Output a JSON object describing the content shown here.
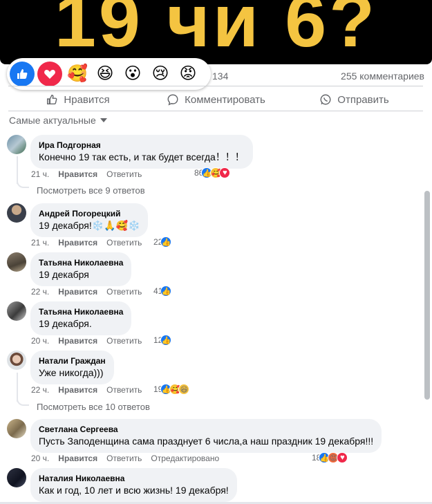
{
  "hero": {
    "text": "19 чи 6?",
    "accent": "#f4c441"
  },
  "reactions": {
    "icons": [
      "like-icon",
      "love-icon",
      "care-icon",
      "haha-icon",
      "wow-icon",
      "sad-icon",
      "angry-icon"
    ],
    "count": "134",
    "comments_count": "255 комментариев"
  },
  "actions": {
    "like": "Нравится",
    "comment": "Комментировать",
    "share": "Отправить"
  },
  "sort": {
    "label": "Самые актуальные"
  },
  "comments": [
    {
      "author": "Ира Подгорная",
      "text": "Конечно 19 так есть, и так будет всегда！！！",
      "time": "21 ч.",
      "like": "Нравится",
      "reply": "Ответить",
      "edited": "",
      "reactions_count": "86",
      "view_replies": "Посмотреть все 9 ответов"
    },
    {
      "author": "Андрей Погорецкий",
      "text": "19 декабря!❄️🙏🥰❄️",
      "time": "21 ч.",
      "like": "Нравится",
      "reply": "Ответить",
      "edited": "",
      "reactions_count": "22",
      "view_replies": ""
    },
    {
      "author": "Татьяна Николаевна",
      "text": "19 декабря",
      "time": "22 ч.",
      "like": "Нравится",
      "reply": "Ответить",
      "edited": "",
      "reactions_count": "41",
      "view_replies": ""
    },
    {
      "author": "Татьяна Николаевна",
      "text": "19 декабря.",
      "time": "20 ч.",
      "like": "Нравится",
      "reply": "Ответить",
      "edited": "",
      "reactions_count": "12",
      "view_replies": ""
    },
    {
      "author": "Натали Граждан",
      "text": "Уже никогда)))",
      "time": "22 ч.",
      "like": "Нравится",
      "reply": "Ответить",
      "edited": "",
      "reactions_count": "19",
      "view_replies": "Посмотреть все 10 ответов"
    },
    {
      "author": "Светлана Сергеева",
      "text": "Пусть Заподенщина сама празднует 6 числа,а наш праздник 19 декабря!!!",
      "time": "20 ч.",
      "like": "Нравится",
      "reply": "Ответить",
      "edited": "Отредактировано",
      "reactions_count": "18",
      "view_replies": ""
    },
    {
      "author": "Наталия Николаевна",
      "text": "Как и год, 10 лет и всю жизнь! 19 декабря!",
      "time": "",
      "like": "",
      "reply": "",
      "edited": "",
      "reactions_count": "",
      "view_replies": ""
    }
  ],
  "colors": {
    "like_blue": "#1877f2",
    "love_red": "#f0284a",
    "muted": "#65676b",
    "bubble": "#f0f2f5"
  }
}
